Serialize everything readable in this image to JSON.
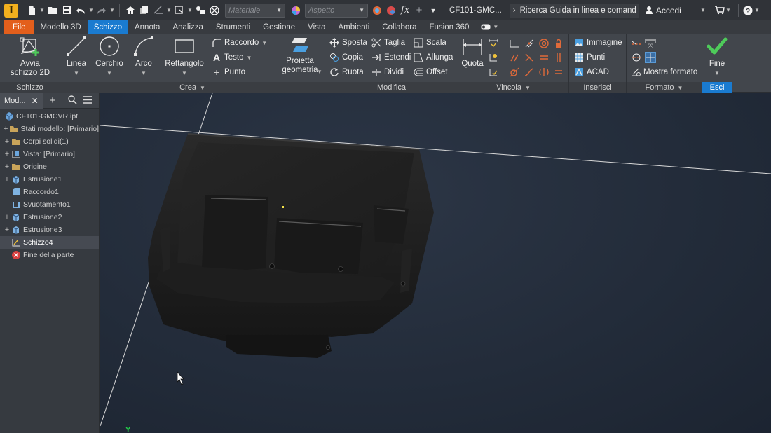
{
  "titlebar": {
    "app_logo": "I",
    "material_placeholder": "Materiale",
    "appearance_placeholder": "Aspetto",
    "doc_title": "CF101-GMC...",
    "search_label": "Ricerca Guida in linea e comand",
    "signin_label": "Accedi"
  },
  "tabs": [
    {
      "label": "File"
    },
    {
      "label": "Modello 3D"
    },
    {
      "label": "Schizzo"
    },
    {
      "label": "Annota"
    },
    {
      "label": "Analizza"
    },
    {
      "label": "Strumenti"
    },
    {
      "label": "Gestione"
    },
    {
      "label": "Vista"
    },
    {
      "label": "Ambienti"
    },
    {
      "label": "Collabora"
    },
    {
      "label": "Fusion 360"
    }
  ],
  "ribbon": {
    "schizzo_panel": {
      "title": "Schizzo",
      "start_sketch": "Avvia schizzo 2D"
    },
    "crea_panel": {
      "title": "Crea",
      "linea": "Linea",
      "cerchio": "Cerchio",
      "arco": "Arco",
      "rettangolo": "Rettangolo",
      "raccordo": "Raccordo",
      "testo": "Testo",
      "punto": "Punto",
      "proietta": "Proietta geometria"
    },
    "modifica_panel": {
      "title": "Modifica",
      "sposta": "Sposta",
      "taglia": "Taglia",
      "scala": "Scala",
      "copia": "Copia",
      "estendi": "Estendi",
      "allunga": "Allunga",
      "ruota": "Ruota",
      "dividi": "Dividi",
      "offset": "Offset"
    },
    "vincola_panel": {
      "title": "Vincola",
      "quota": "Quota"
    },
    "inserisci_panel": {
      "title": "Inserisci",
      "immagine": "Immagine",
      "punti": "Punti",
      "acad": "ACAD"
    },
    "formato_panel": {
      "title": "Formato",
      "mostra_formato": "Mostra formato"
    },
    "esci_panel": {
      "title": "Esci",
      "fine": "Fine"
    }
  },
  "browser": {
    "tab_label": "Mod...",
    "tree": [
      {
        "label": "CF101-GMCVR.ipt",
        "expander": ""
      },
      {
        "label": "Stati modello: [Primario]",
        "expander": "+"
      },
      {
        "label": "Corpi solidi(1)",
        "expander": "+"
      },
      {
        "label": "Vista: [Primario]",
        "expander": "+"
      },
      {
        "label": "Origine",
        "expander": "+"
      },
      {
        "label": "Estrusione1",
        "expander": "+"
      },
      {
        "label": "Raccordo1",
        "expander": ""
      },
      {
        "label": "Svuotamento1",
        "expander": ""
      },
      {
        "label": "Estrusione2",
        "expander": "+"
      },
      {
        "label": "Estrusione3",
        "expander": "+"
      },
      {
        "label": "Schizzo4",
        "expander": ""
      },
      {
        "label": "Fine della parte",
        "expander": ""
      }
    ]
  },
  "viewport": {
    "axis_label": "Y"
  },
  "colors": {
    "accent": "#1a7bd0",
    "file_tab": "#e35f1c",
    "fine_check": "#4ecb5a",
    "axis_green": "#22d24a"
  }
}
